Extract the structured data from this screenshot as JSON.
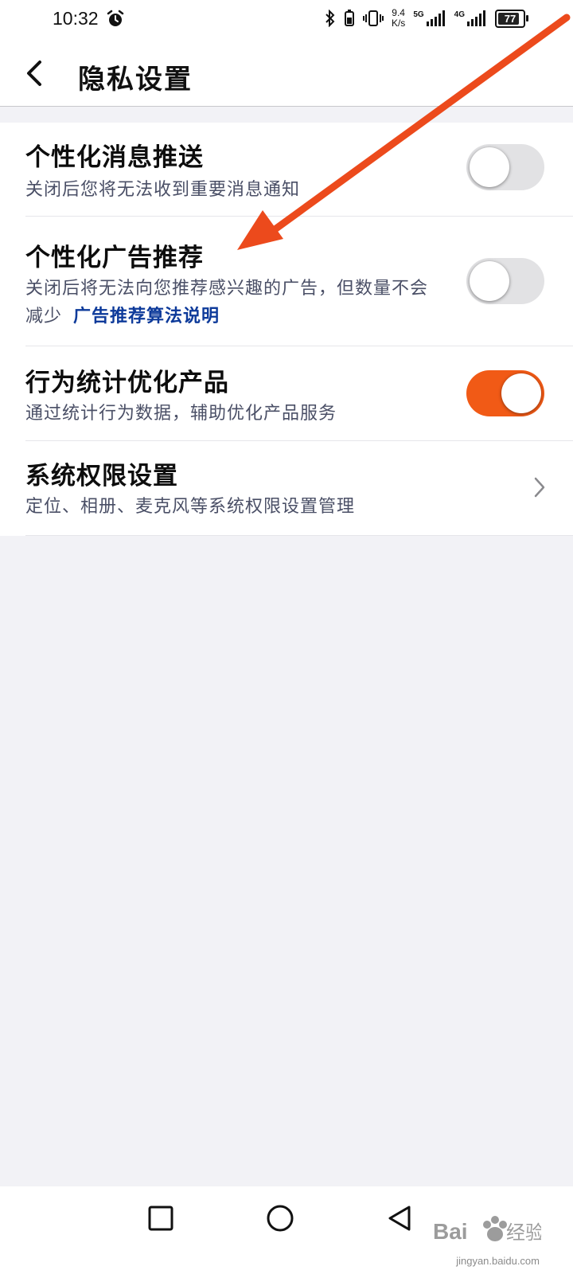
{
  "status_bar": {
    "time": "10:32",
    "speed_value": "9.4",
    "speed_unit": "K/s",
    "sim1_label": "5G",
    "sim2_label": "4G",
    "battery": "77"
  },
  "header": {
    "title": "隐私设置"
  },
  "settings": [
    {
      "title": "个性化消息推送",
      "desc": "关闭后您将无法收到重要消息通知",
      "enabled": false
    },
    {
      "title": "个性化广告推荐",
      "desc": "关闭后将无法向您推荐感兴趣的广告，但数量不会减少",
      "link": "广告推荐算法说明",
      "enabled": false
    },
    {
      "title": "行为统计优化产品",
      "desc": "通过统计行为数据，辅助优化产品服务",
      "enabled": true
    },
    {
      "title": "系统权限设置",
      "desc": "定位、相册、麦克风等系统权限设置管理"
    }
  ],
  "colors": {
    "accent": "#f15a16",
    "link": "#0d3a9a",
    "annotation_arrow": "#ec4a1c"
  },
  "icons": {
    "back": "back-arrow-icon",
    "chevron": "chevron-right-icon",
    "nav": [
      "recent-apps-icon",
      "home-icon",
      "back-icon"
    ]
  },
  "watermark": {
    "text": "jingyan.baidu.com"
  }
}
